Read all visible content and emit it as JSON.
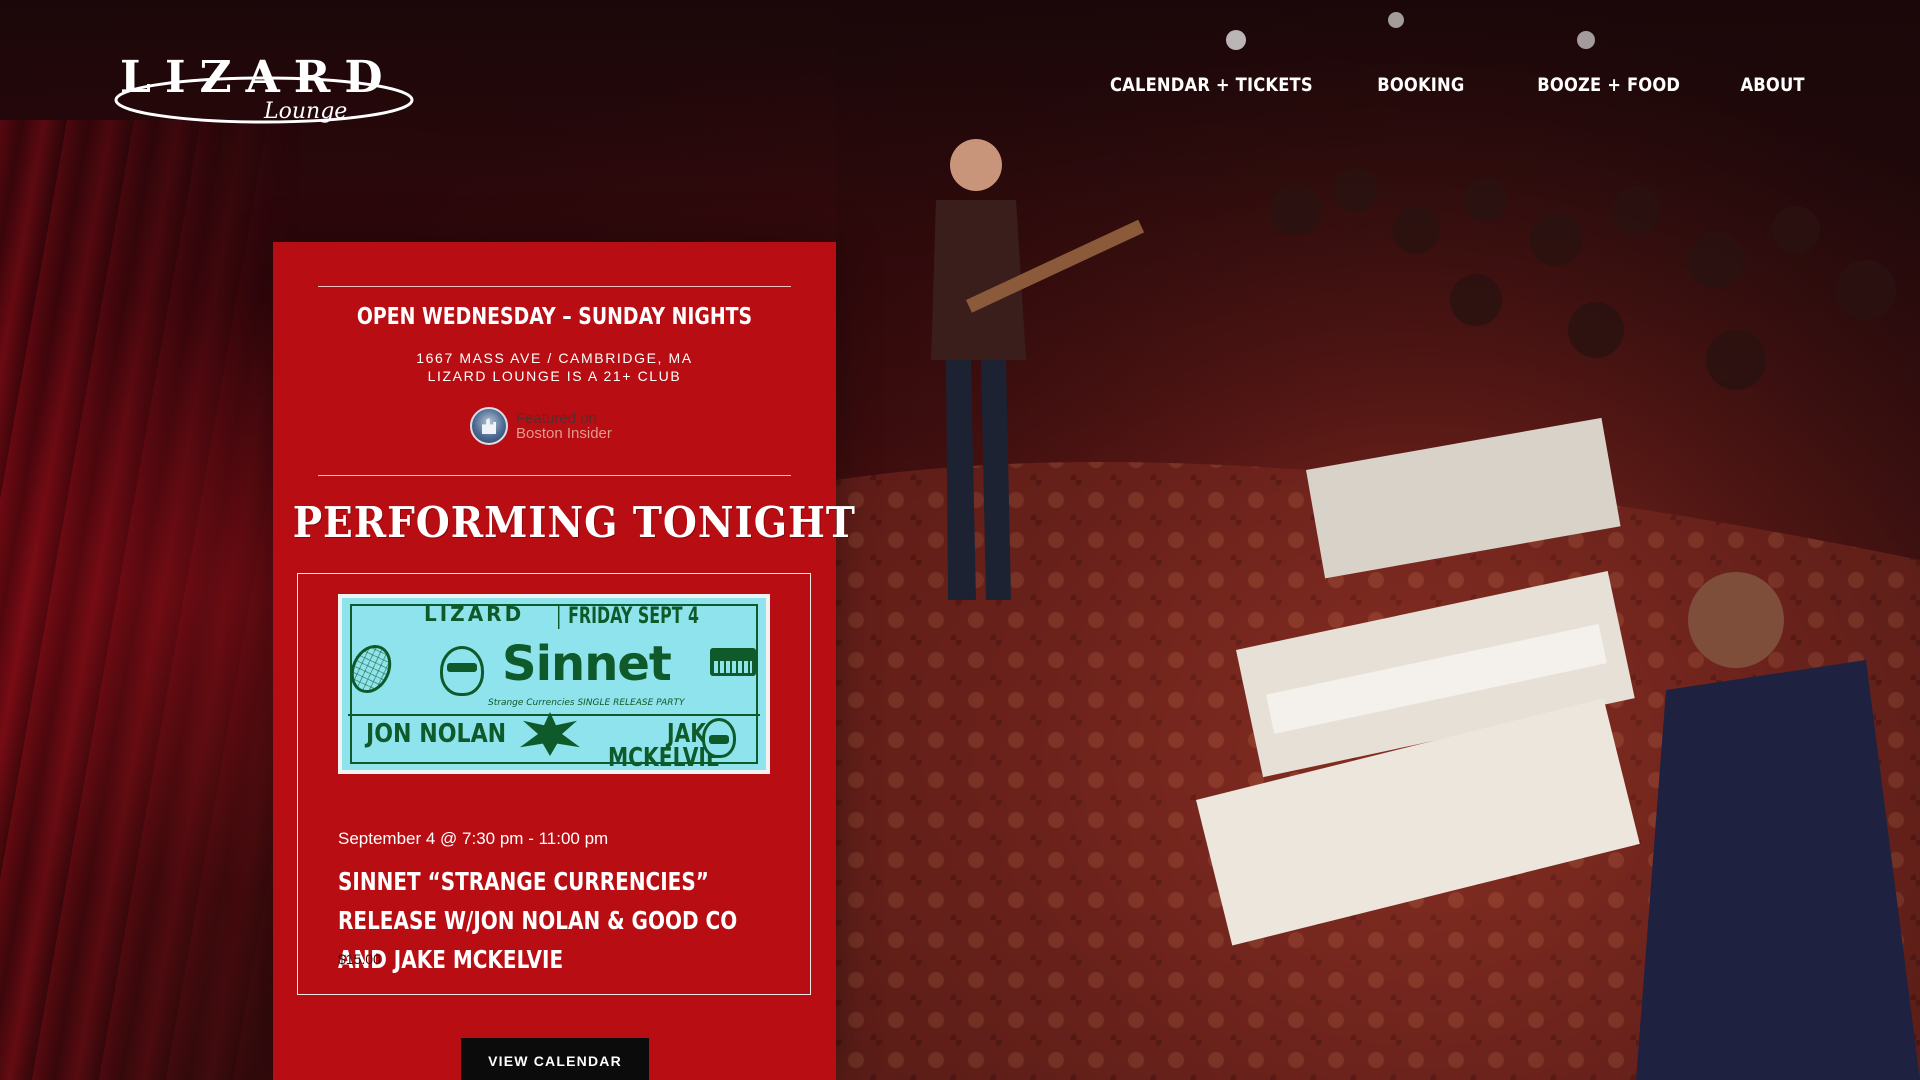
{
  "brand": {
    "logo_text": "LIZARD",
    "logo_script": "Lounge"
  },
  "nav": {
    "items": [
      {
        "label": "CALENDAR + TICKETS"
      },
      {
        "label": "BOOKING"
      },
      {
        "label": "BOOZE + FOOD"
      },
      {
        "label": "ABOUT"
      }
    ]
  },
  "info": {
    "hours_title": "OPEN WEDNESDAY – SUNDAY NIGHTS",
    "address_line": "1667 MASS AVE / CAMBRIDGE, MA",
    "age_line": "LIZARD LOUNGE IS A 21+ CLUB",
    "featured_line1": "Featured on",
    "featured_line2": "Boston Insider"
  },
  "tonight": {
    "heading": "PERFORMING TONIGHT",
    "flyer": {
      "venue": "LIZARD",
      "date": "FRIDAY SEPT 4",
      "headliner": "Sinnet",
      "subtitle": "Strange Currencies SINGLE RELEASE PARTY",
      "act2": "JON NOLAN",
      "act3": "JAKE MCKELVIE"
    },
    "when": "September 4 @ 7:30 pm - 11:00 pm",
    "title": "SINNET “STRANGE CURRENCIES” RELEASE W/JON NOLAN & GOOD CO AND JAKE MCKELVIE",
    "price": "$15.00",
    "button": "VIEW CALENDAR"
  },
  "colors": {
    "panel_red": "#b80d12",
    "flyer_bg": "#8fe3ec",
    "flyer_ink": "#0f5a2a",
    "button_bg": "#0b0b0b"
  }
}
